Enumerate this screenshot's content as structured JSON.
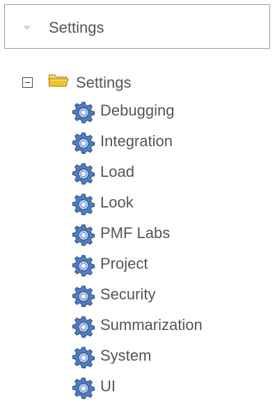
{
  "header": {
    "title": "Settings",
    "caret_icon": "caret-down-icon",
    "caret_color": "#d3d3d3"
  },
  "tree": {
    "root": {
      "label": "Settings",
      "expanded": true,
      "toggle_icon": "minus-box-icon",
      "folder_icon": "folder-open-icon",
      "folder_color": "#f2c230"
    },
    "items": [
      {
        "label": "Debugging",
        "icon": "gear-icon"
      },
      {
        "label": "Integration",
        "icon": "gear-icon"
      },
      {
        "label": "Load",
        "icon": "gear-icon"
      },
      {
        "label": "Look",
        "icon": "gear-icon"
      },
      {
        "label": "PMF Labs",
        "icon": "gear-icon"
      },
      {
        "label": "Project",
        "icon": "gear-icon"
      },
      {
        "label": "Security",
        "icon": "gear-icon"
      },
      {
        "label": "Summarization",
        "icon": "gear-icon"
      },
      {
        "label": "System",
        "icon": "gear-icon"
      },
      {
        "label": "UI",
        "icon": "gear-icon"
      }
    ]
  },
  "colors": {
    "text": "#555555",
    "border": "#9a9a9a",
    "gear_blue": "#3f6fb4"
  }
}
